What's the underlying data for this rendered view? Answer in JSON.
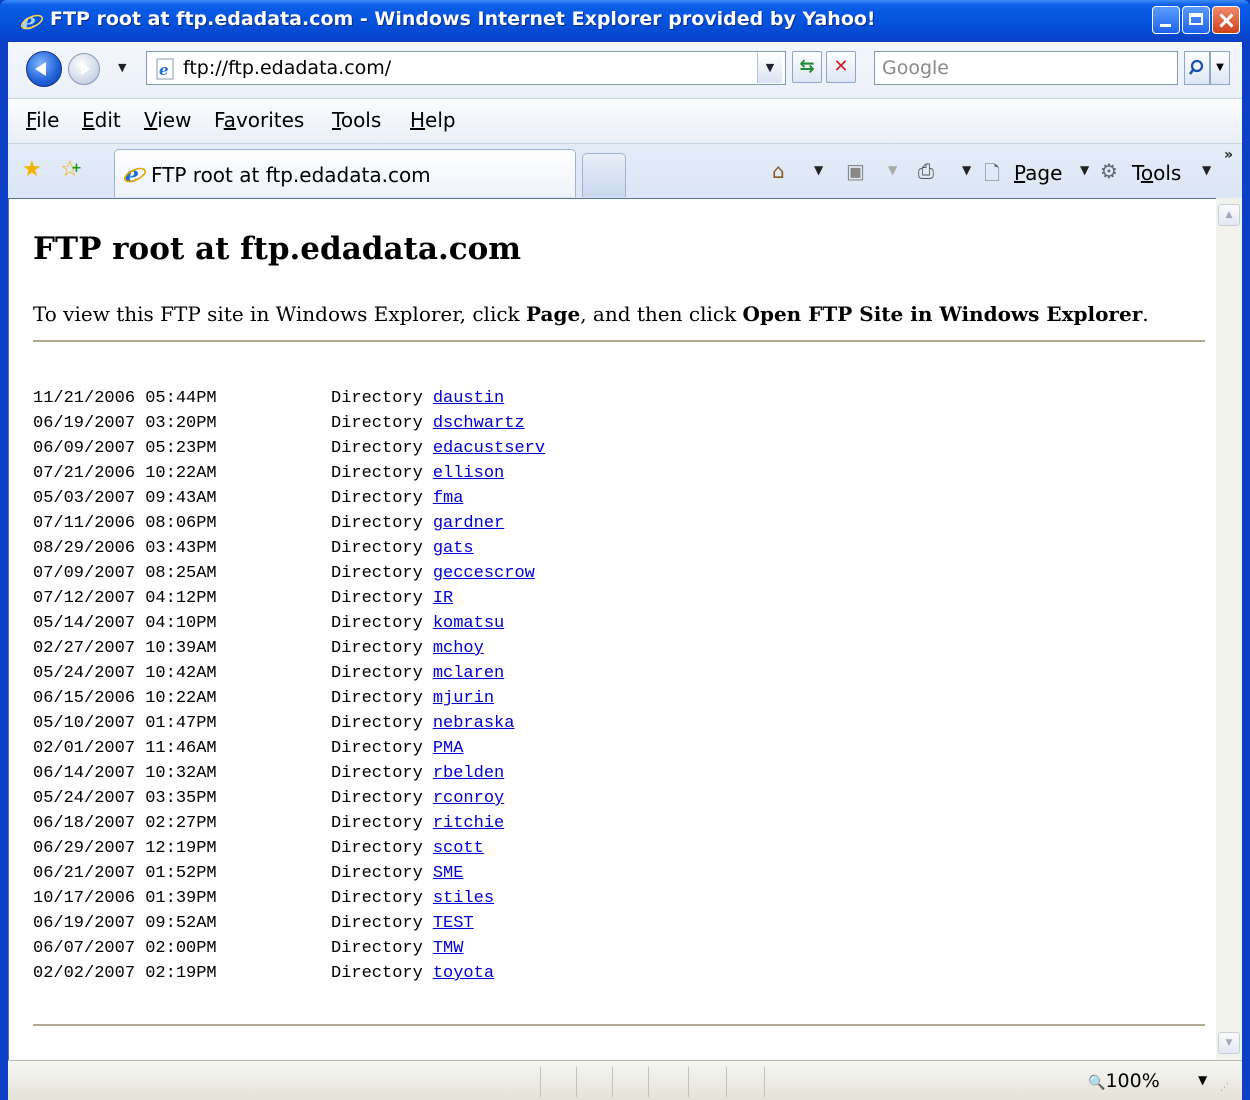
{
  "window": {
    "title": "FTP root at ftp.edadata.com - Windows Internet Explorer provided by Yahoo!"
  },
  "navbar": {
    "address": "ftp://ftp.edadata.com/",
    "search_placeholder": "Google"
  },
  "menu": {
    "items": [
      {
        "pre": "",
        "u": "F",
        "post": "ile"
      },
      {
        "pre": "",
        "u": "E",
        "post": "dit"
      },
      {
        "pre": "",
        "u": "V",
        "post": "iew"
      },
      {
        "pre": "F",
        "u": "a",
        "post": "vorites"
      },
      {
        "pre": "",
        "u": "T",
        "post": "ools"
      },
      {
        "pre": "",
        "u": "H",
        "post": "elp"
      }
    ]
  },
  "tabbar": {
    "tab_title": "FTP root at ftp.edadata.com",
    "page_pre": "",
    "page_u": "P",
    "page_post": "age",
    "tools_pre": "T",
    "tools_u": "o",
    "tools_post": "ols",
    "chevron": "»"
  },
  "content": {
    "heading": "FTP root at ftp.edadata.com",
    "instr_1": "To view this FTP site in Windows Explorer, click ",
    "instr_b1": "Page",
    "instr_2": ", and then click ",
    "instr_b2": "Open FTP Site in Windows Explorer",
    "instr_3": ".",
    "entry_type": "Directory",
    "entries": [
      {
        "date": "11/21/2006 05:44PM",
        "name": "daustin"
      },
      {
        "date": "06/19/2007 03:20PM",
        "name": "dschwartz"
      },
      {
        "date": "06/09/2007 05:23PM",
        "name": "edacustserv"
      },
      {
        "date": "07/21/2006 10:22AM",
        "name": "ellison"
      },
      {
        "date": "05/03/2007 09:43AM",
        "name": "fma"
      },
      {
        "date": "07/11/2006 08:06PM",
        "name": "gardner"
      },
      {
        "date": "08/29/2006 03:43PM",
        "name": "gats"
      },
      {
        "date": "07/09/2007 08:25AM",
        "name": "geccescrow"
      },
      {
        "date": "07/12/2007 04:12PM",
        "name": "IR"
      },
      {
        "date": "05/14/2007 04:10PM",
        "name": "komatsu"
      },
      {
        "date": "02/27/2007 10:39AM",
        "name": "mchoy"
      },
      {
        "date": "05/24/2007 10:42AM",
        "name": "mclaren"
      },
      {
        "date": "06/15/2006 10:22AM",
        "name": "mjurin"
      },
      {
        "date": "05/10/2007 01:47PM",
        "name": "nebraska"
      },
      {
        "date": "02/01/2007 11:46AM",
        "name": "PMA"
      },
      {
        "date": "06/14/2007 10:32AM",
        "name": "rbelden"
      },
      {
        "date": "05/24/2007 03:35PM",
        "name": "rconroy"
      },
      {
        "date": "06/18/2007 02:27PM",
        "name": "ritchie"
      },
      {
        "date": "06/29/2007 12:19PM",
        "name": "scott"
      },
      {
        "date": "06/21/2007 01:52PM",
        "name": "SME"
      },
      {
        "date": "10/17/2006 01:39PM",
        "name": "stiles"
      },
      {
        "date": "06/19/2007 09:52AM",
        "name": "TEST"
      },
      {
        "date": "06/07/2007 02:00PM",
        "name": "TMW"
      },
      {
        "date": "02/02/2007 02:19PM",
        "name": "toyota"
      }
    ]
  },
  "statusbar": {
    "zoom": "100%"
  },
  "colors": {
    "titlebar": "#0453dd",
    "link": "#0000d4",
    "rule": "#b0a890"
  }
}
